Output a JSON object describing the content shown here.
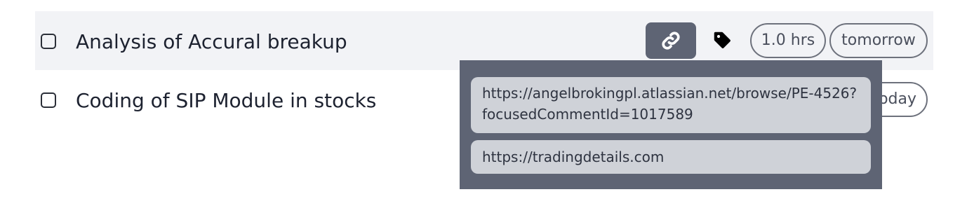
{
  "tasks": [
    {
      "title": "Analysis of Accural breakup",
      "link_icon": "link-icon",
      "tag_icon": "tag-icon",
      "hours": "1.0 hrs",
      "due": "tomorrow"
    },
    {
      "title": "Coding of SIP Module in stocks",
      "due_partial": "oday"
    }
  ],
  "links_popup": {
    "links": [
      "https://angelbrokingpl.atlassian.net/browse/PE-4526?focusedCommentId=1017589",
      "https://tradingdetails.com"
    ]
  },
  "colors": {
    "row_highlight": "#f2f3f6",
    "popup_bg": "#5e6474",
    "link_item_bg": "#cfd2d8",
    "pill_border": "#6d717c"
  }
}
